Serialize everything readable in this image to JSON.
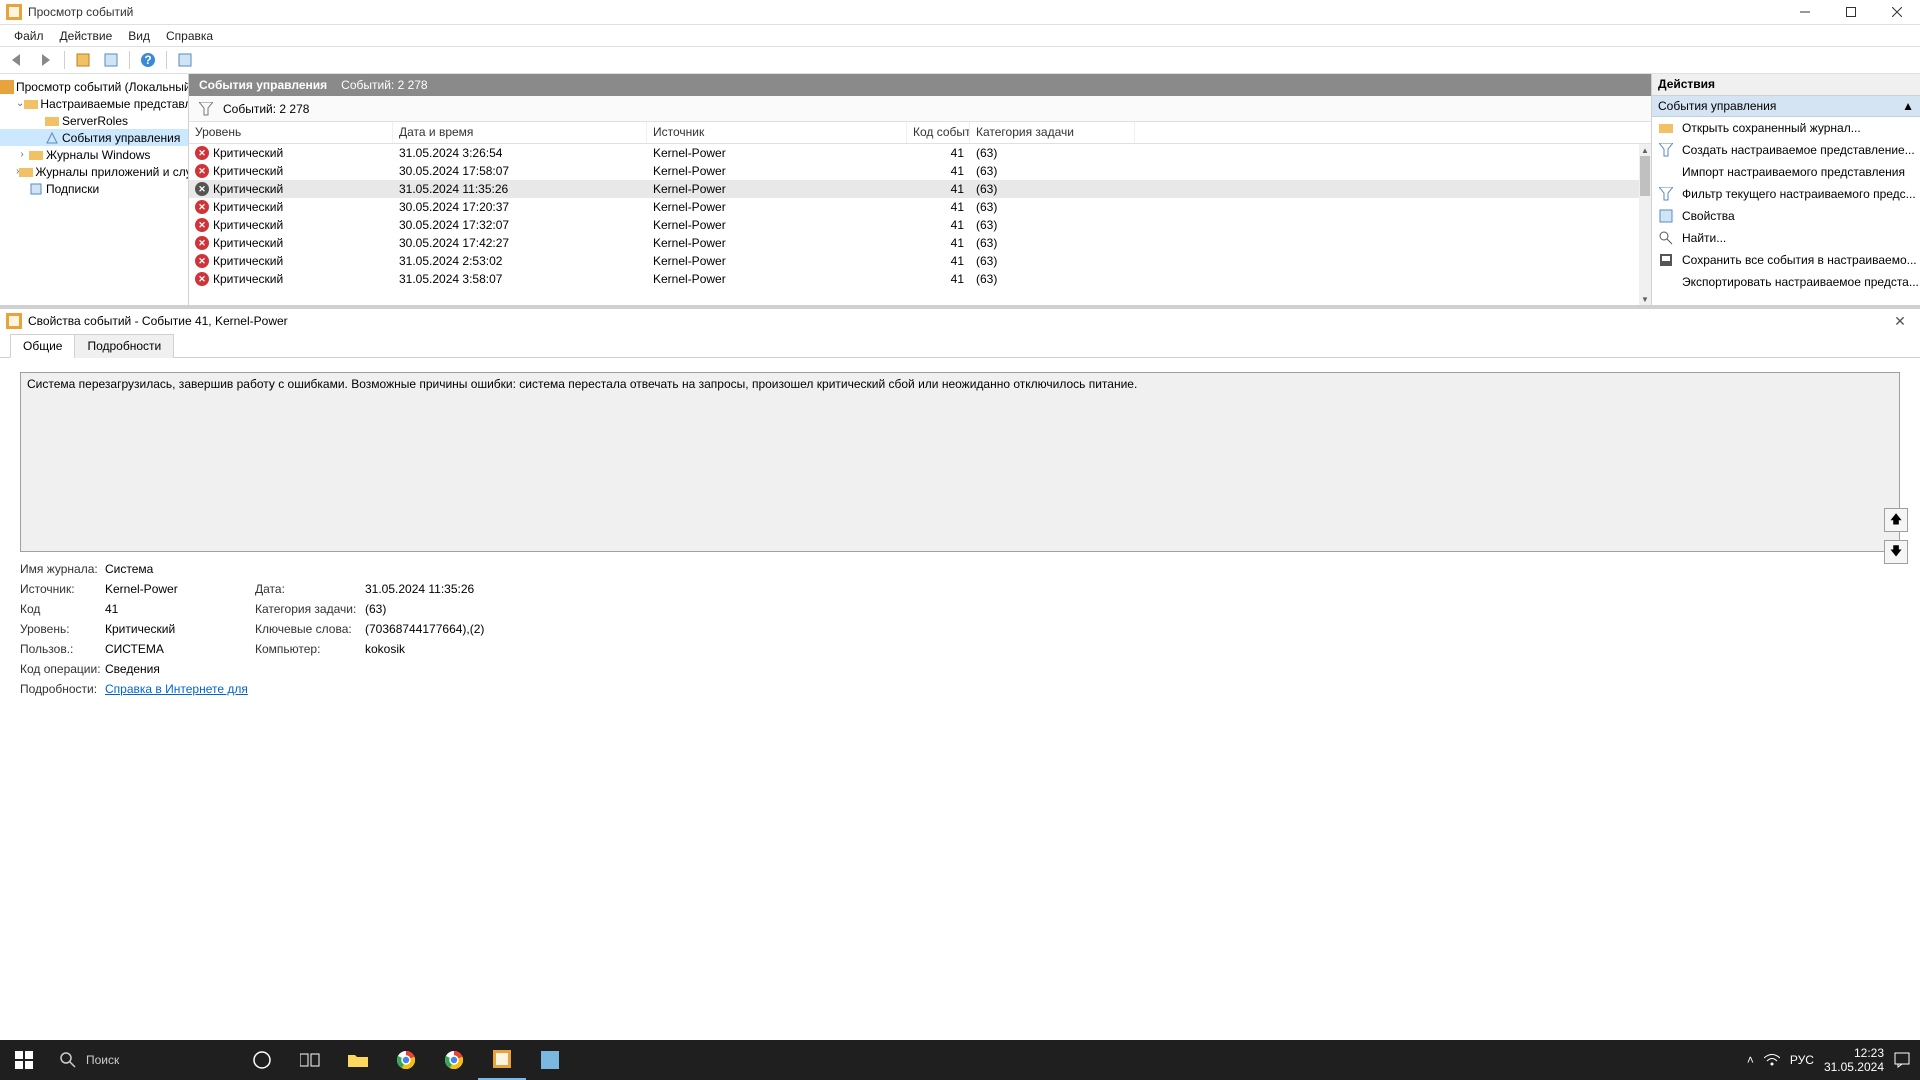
{
  "window": {
    "title": "Просмотр событий"
  },
  "menu": [
    "Файл",
    "Действие",
    "Вид",
    "Справка"
  ],
  "tree": {
    "root": "Просмотр событий (Локальный)",
    "custom_views": "Настраиваемые представления",
    "server_roles": "ServerRoles",
    "admin_events": "События управления",
    "windows_logs": "Журналы Windows",
    "app_logs": "Журналы приложений и служб",
    "subscriptions": "Подписки"
  },
  "center": {
    "title": "События управления",
    "count_label": "Событий: 2 278",
    "filter_label": "Событий: 2 278",
    "columns": {
      "level": "Уровень",
      "date": "Дата и время",
      "source": "Источник",
      "code": "Код события",
      "task": "Категория задачи"
    },
    "rows": [
      {
        "sev": "crit",
        "level": "Критический",
        "date": "31.05.2024 3:26:54",
        "source": "Kernel-Power",
        "code": "41",
        "task": "(63)"
      },
      {
        "sev": "crit",
        "level": "Критический",
        "date": "30.05.2024 17:58:07",
        "source": "Kernel-Power",
        "code": "41",
        "task": "(63)"
      },
      {
        "sev": "info",
        "level": "Критический",
        "date": "31.05.2024 11:35:26",
        "source": "Kernel-Power",
        "code": "41",
        "task": "(63)",
        "selected": true
      },
      {
        "sev": "crit",
        "level": "Критический",
        "date": "30.05.2024 17:20:37",
        "source": "Kernel-Power",
        "code": "41",
        "task": "(63)"
      },
      {
        "sev": "crit",
        "level": "Критический",
        "date": "30.05.2024 17:32:07",
        "source": "Kernel-Power",
        "code": "41",
        "task": "(63)"
      },
      {
        "sev": "crit",
        "level": "Критический",
        "date": "30.05.2024 17:42:27",
        "source": "Kernel-Power",
        "code": "41",
        "task": "(63)"
      },
      {
        "sev": "crit",
        "level": "Критический",
        "date": "31.05.2024 2:53:02",
        "source": "Kernel-Power",
        "code": "41",
        "task": "(63)"
      },
      {
        "sev": "crit",
        "level": "Критический",
        "date": "31.05.2024 3:58:07",
        "source": "Kernel-Power",
        "code": "41",
        "task": "(63)"
      }
    ]
  },
  "actions": {
    "header": "Действия",
    "section": "События управления",
    "items": [
      "Открыть сохраненный журнал...",
      "Создать настраиваемое представление...",
      "Импорт настраиваемого представления",
      "Фильтр текущего настраиваемого предс...",
      "Свойства",
      "Найти...",
      "Сохранить все события в настраиваемо...",
      "Экспортировать настраиваемое предста..."
    ]
  },
  "prop": {
    "title": "Свойства событий - Событие 41, Kernel-Power",
    "tabs": {
      "general": "Общие",
      "details": "Подробности"
    },
    "description": "Система перезагрузилась, завершив работу с ошибками. Возможные причины ошибки: система перестала отвечать на запросы, произошел критический сбой или неожиданно отключилось питание.",
    "fields": {
      "log_name_k": "Имя журнала:",
      "log_name_v": "Система",
      "source_k": "Источник:",
      "source_v": "Kernel-Power",
      "date_k": "Дата:",
      "date_v": "31.05.2024 11:35:26",
      "code_k": "Код",
      "code_v": "41",
      "task_k": "Категория задачи:",
      "task_v": "(63)",
      "level_k": "Уровень:",
      "level_v": "Критический",
      "keywords_k": "Ключевые слова:",
      "keywords_v": "(70368744177664),(2)",
      "user_k": "Пользов.:",
      "user_v": "СИСТЕМА",
      "computer_k": "Компьютер:",
      "computer_v": "kokosik",
      "opcode_k": "Код операции:",
      "opcode_v": "Сведения",
      "details_k": "Подробности:",
      "details_link": "Справка в Интернете для"
    }
  },
  "taskbar": {
    "search_placeholder": "Поиск",
    "lang": "РУС",
    "time": "12:23",
    "date": "31.05.2024"
  }
}
